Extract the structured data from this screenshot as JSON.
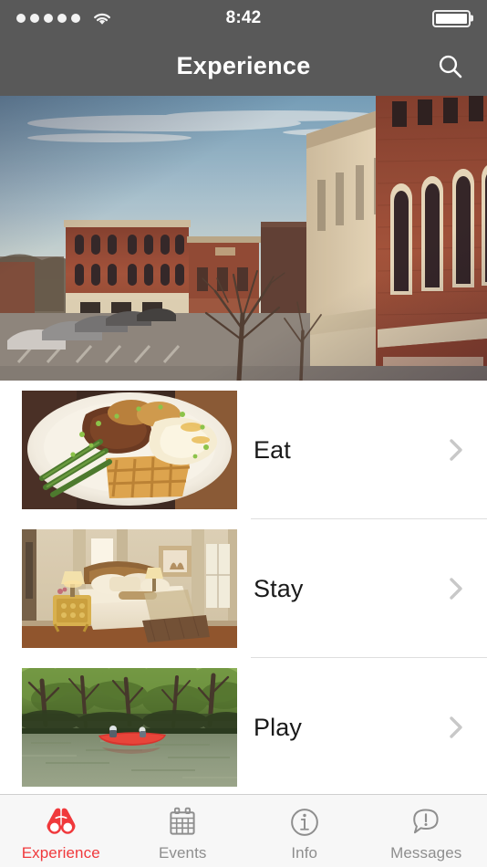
{
  "status_bar": {
    "signal_dots": 5,
    "signal_icon": "signal-dots",
    "wifi_icon": "wifi-icon",
    "time": "8:42",
    "battery_icon": "battery-full-icon",
    "battery_level": "full"
  },
  "nav_bar": {
    "title": "Experience",
    "search_icon": "search-icon"
  },
  "hero": {
    "name": "downtown-street-scene",
    "alt": "Historic downtown brick buildings along a street at golden hour"
  },
  "colors": {
    "nav_background": "#595959",
    "accent_red": "#f0393c",
    "tab_inactive": "#8e8e8e",
    "separator": "#dedede",
    "tab_bar_background": "#f7f7f7"
  },
  "list": {
    "rows": [
      {
        "label": "Eat",
        "thumb_name": "food-plate-photo",
        "thumb_alt": "Plate of chicken, waffles, asparagus and grits",
        "chevron_icon": "chevron-right-icon"
      },
      {
        "label": "Stay",
        "thumb_name": "bedroom-photo",
        "thumb_alt": "Hotel bedroom with bed, lamps and framed art",
        "chevron_icon": "chevron-right-icon"
      },
      {
        "label": "Play",
        "thumb_name": "river-canoe-photo",
        "thumb_alt": "Red canoe on a green river lined with trees",
        "chevron_icon": "chevron-right-icon"
      }
    ]
  },
  "tab_bar": {
    "tabs": [
      {
        "label": "Experience",
        "icon": "binoculars-icon",
        "active": true
      },
      {
        "label": "Events",
        "icon": "calendar-icon",
        "active": false
      },
      {
        "label": "Info",
        "icon": "info-circle-icon",
        "active": false
      },
      {
        "label": "Messages",
        "icon": "message-alert-icon",
        "active": false
      }
    ]
  }
}
